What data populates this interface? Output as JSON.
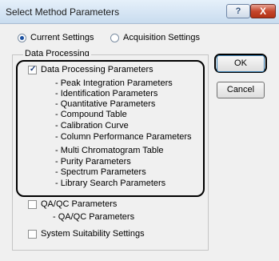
{
  "window": {
    "title": "Select Method Parameters"
  },
  "titlebar": {
    "help_label": "?",
    "close_label": "X"
  },
  "settings_mode": {
    "current_label": "Current Settings",
    "acquisition_label": "Acquisition Settings",
    "selected": "current"
  },
  "data_processing": {
    "group_label": "Data Processing",
    "main_label": "Data Processing Parameters",
    "main_checked": true,
    "items": [
      "- Peak Integration Parameters",
      "- Identification Parameters",
      "- Quantitative Parameters",
      "- Compound Table",
      "- Calibration Curve",
      "- Column Performance Parameters",
      "- Multi Chromatogram Table",
      "- Purity Parameters",
      "- Spectrum Parameters",
      "- Library Search Parameters"
    ]
  },
  "qaqc": {
    "label": "QA/QC Parameters",
    "checked": false,
    "items": [
      "- QA/QC Parameters"
    ]
  },
  "system_suitability": {
    "label": "System Suitability Settings",
    "checked": false
  },
  "buttons": {
    "ok_label": "OK",
    "cancel_label": "Cancel"
  }
}
